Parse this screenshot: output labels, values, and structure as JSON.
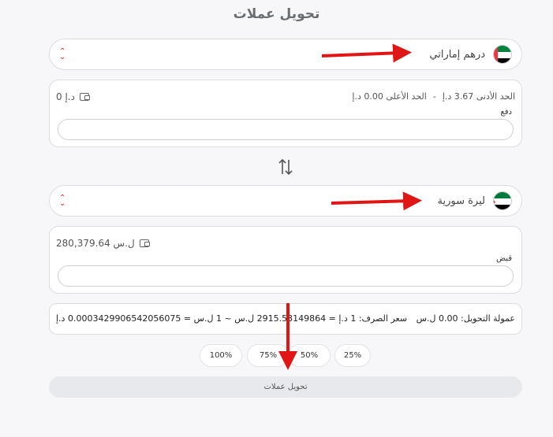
{
  "page": {
    "title": "تحويل عملات"
  },
  "from": {
    "currency_name": "درهم إماراتي",
    "flag_icon": "uae-flag-icon",
    "min_label": "الحد الأدنى 3.67 د.إ",
    "separator": "-",
    "max_label": "الحد الأعلى 0.00 د.إ",
    "balance": "0 د.إ",
    "field_label": "دفع",
    "input_value": ""
  },
  "to": {
    "currency_name": "ليرة سورية",
    "flag_icon": "syria-flag-icon",
    "balance": "280,379.64 ل.س",
    "field_label": "قبض",
    "input_value": ""
  },
  "info": {
    "fee": "عمولة التحويل: 0.00 ل.س",
    "rate": "سعر الصرف: 1 د.إ = 2915.53149864 ل.س ~ 1 ل.س = 0.0003429906542056075 د.إ"
  },
  "percent_buttons": [
    "100%",
    "75%",
    "50%",
    "25%"
  ],
  "convert_button": "تحويل عملات",
  "colors": {
    "accent_red": "#e0221e",
    "button_bg": "#e8e9ec"
  }
}
